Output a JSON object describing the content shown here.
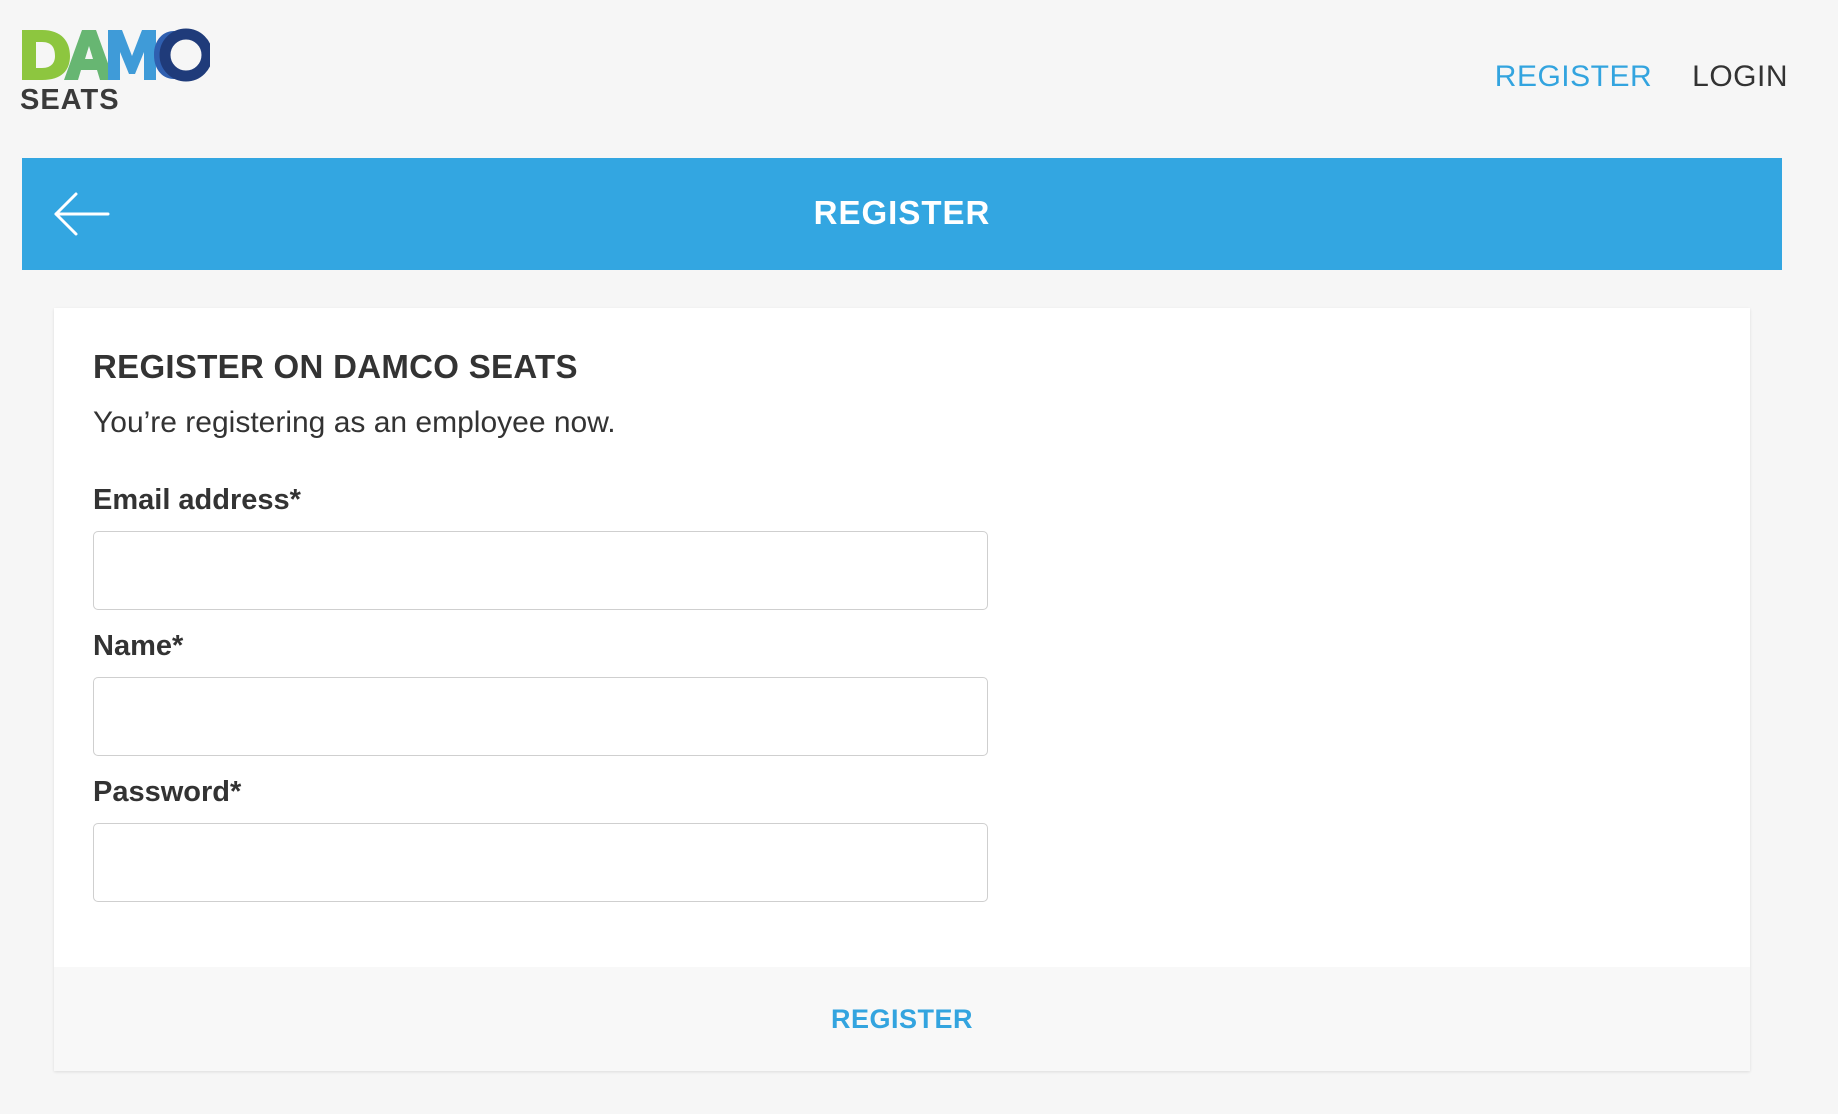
{
  "brand": {
    "logo_word": "DAMCO",
    "logo_sub": "SEATS",
    "colors": {
      "green": "#8dc63f",
      "blue": "#3f9bd8",
      "navy": "#1f3b7a"
    }
  },
  "nav": {
    "register": "REGISTER",
    "login": "LOGIN"
  },
  "title_bar": {
    "title": "REGISTER",
    "back_icon": "arrow-left-icon"
  },
  "form": {
    "heading": "REGISTER ON DAMCO SEATS",
    "subtitle": "You’re registering as an employee now.",
    "email": {
      "label": "Email address*",
      "value": ""
    },
    "name": {
      "label": "Name*",
      "value": ""
    },
    "password": {
      "label": "Password*",
      "value": ""
    },
    "submit_label": "REGISTER"
  },
  "colors": {
    "accent": "#33a6e1",
    "text": "#333333",
    "background": "#f6f6f6"
  }
}
